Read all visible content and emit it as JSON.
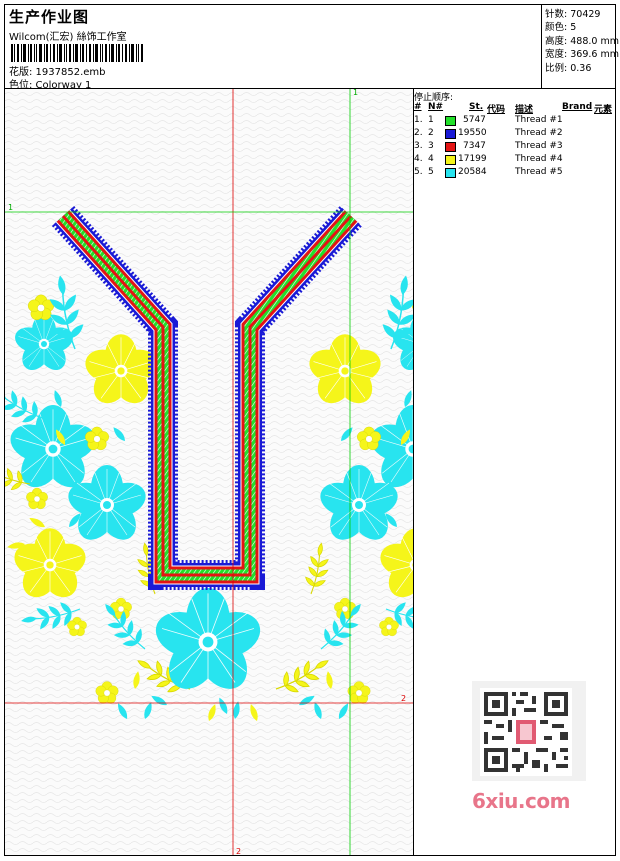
{
  "header": {
    "title": "生产作业图",
    "subtitle": "Wilcom(汇宏) 絲饰工作室",
    "design_label": "花版: 1937852.emb",
    "colorway_label": "色位: Colorway 1"
  },
  "stats": [
    {
      "label": "针数:",
      "value": "70429"
    },
    {
      "label": "颜色:",
      "value": "5"
    },
    {
      "label": "高度:",
      "value": "488.0 mm"
    },
    {
      "label": "宽度:",
      "value": "369.6 mm"
    },
    {
      "label": "比例:",
      "value": "0.36"
    }
  ],
  "stop_sequence": {
    "title": "停止顺序:",
    "headers": {
      "index": "#",
      "needle": "N#",
      "st": "St.",
      "code": "代码",
      "desc": "描述",
      "brand": "Brand",
      "element": "元素"
    },
    "rows": [
      {
        "index": "1.",
        "needle": "1",
        "color": "#22e02a",
        "code": "5747",
        "desc": "Thread #1"
      },
      {
        "index": "2.",
        "needle": "2",
        "color": "#1a1ad6",
        "code": "19550",
        "desc": "Thread #2"
      },
      {
        "index": "3.",
        "needle": "3",
        "color": "#e41414",
        "code": "7347",
        "desc": "Thread #3"
      },
      {
        "index": "4.",
        "needle": "4",
        "color": "#f5f51a",
        "code": "17199",
        "desc": "Thread #4"
      },
      {
        "index": "5.",
        "needle": "5",
        "color": "#28e4ef",
        "code": "20584",
        "desc": "Thread #5"
      }
    ]
  },
  "guides": {
    "top_right": "1",
    "left": "1",
    "right": "2",
    "bottom": "2"
  },
  "thread_colors": {
    "green": "#22e02a",
    "blue": "#1a1ad6",
    "red": "#e41414",
    "yellow": "#f5f51a",
    "cyan": "#28e4ef",
    "guide_red": "#dd0000",
    "guide_green": "#00cc00"
  },
  "watermark": {
    "text": "6xiu.com",
    "icon": "qr-code-icon"
  }
}
